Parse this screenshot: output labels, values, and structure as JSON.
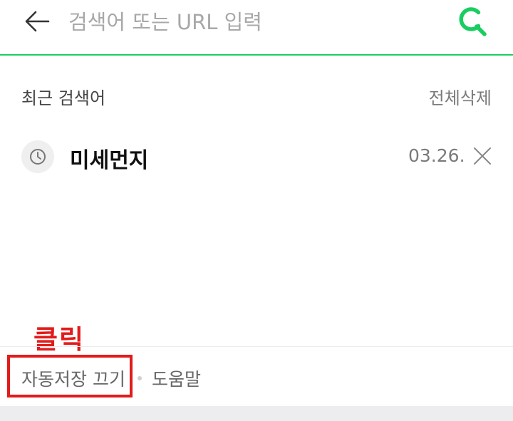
{
  "search": {
    "placeholder": "검색어 또는 URL 입력",
    "value": ""
  },
  "recent": {
    "title": "최근 검색어",
    "delete_all_label": "전체삭제",
    "items": [
      {
        "keyword": "미세먼지",
        "date": "03.26."
      }
    ]
  },
  "annotation": {
    "text": "클릭"
  },
  "footer": {
    "autosave_off_label": "자동저장 끄기",
    "help_label": "도움말"
  },
  "colors": {
    "brand_green": "#19ce60",
    "annotation_red": "#e21b1b"
  },
  "icons": {
    "back": "back-arrow-icon",
    "search": "search-icon",
    "history": "clock-icon",
    "remove": "close-icon"
  }
}
